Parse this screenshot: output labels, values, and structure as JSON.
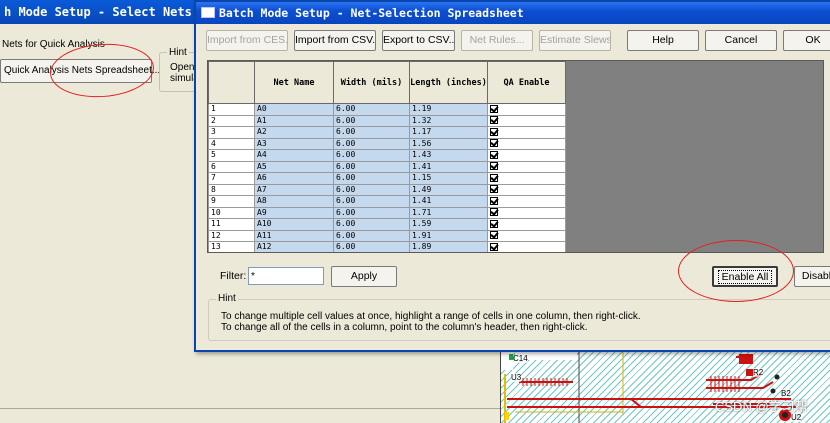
{
  "background_window": {
    "title": "h Mode Setup - Select Nets a",
    "group_label": "Nets for Quick Analysis",
    "qa_button_label": "Quick Analysis Nets Spreadsheet...",
    "hint_label": "Hint",
    "hint_text_line1": "Open",
    "hint_text_line2": "simula"
  },
  "dialog": {
    "title": "Batch Mode Setup - Net-Selection Spreadsheet",
    "toolbar": {
      "import_ces": "Import from CES...",
      "import_csv": "Import from CSV...",
      "export_csv": "Export to CSV...",
      "net_rules": "Net Rules...",
      "estimate_slews": "Estimate Slews",
      "help": "Help",
      "cancel": "Cancel",
      "ok": "OK"
    },
    "columns": [
      "Net Name",
      "Width (mils)",
      "Length (inches)",
      "QA Enable"
    ],
    "rows": [
      {
        "num": "1",
        "name": "A0",
        "width": "6.00",
        "length": "1.19",
        "qa": true
      },
      {
        "num": "2",
        "name": "A1",
        "width": "6.00",
        "length": "1.32",
        "qa": true
      },
      {
        "num": "3",
        "name": "A2",
        "width": "6.00",
        "length": "1.17",
        "qa": true
      },
      {
        "num": "4",
        "name": "A3",
        "width": "6.00",
        "length": "1.56",
        "qa": true
      },
      {
        "num": "5",
        "name": "A4",
        "width": "6.00",
        "length": "1.43",
        "qa": true
      },
      {
        "num": "6",
        "name": "A5",
        "width": "6.00",
        "length": "1.41",
        "qa": true
      },
      {
        "num": "7",
        "name": "A6",
        "width": "6.00",
        "length": "1.15",
        "qa": true
      },
      {
        "num": "8",
        "name": "A7",
        "width": "6.00",
        "length": "1.49",
        "qa": true
      },
      {
        "num": "9",
        "name": "A8",
        "width": "6.00",
        "length": "1.41",
        "qa": true
      },
      {
        "num": "10",
        "name": "A9",
        "width": "6.00",
        "length": "1.71",
        "qa": true
      },
      {
        "num": "11",
        "name": "A10",
        "width": "6.00",
        "length": "1.59",
        "qa": true
      },
      {
        "num": "12",
        "name": "A11",
        "width": "6.00",
        "length": "1.91",
        "qa": true
      },
      {
        "num": "13",
        "name": "A12",
        "width": "6.00",
        "length": "1.89",
        "qa": true
      }
    ],
    "filter": {
      "label": "Filter:",
      "value": "*",
      "apply": "Apply"
    },
    "enable_all": "Enable All",
    "disable_all": "Disabl",
    "hint": {
      "label": "Hint",
      "line1": "To change multiple cell values at once, highlight a range of cells in one column, then right-click.",
      "line2": "To change all of the cells in a column, point to the column's header, then right-click."
    }
  },
  "pcb": {
    "labels": [
      "C14",
      "U3",
      "R2",
      "B2",
      "U2"
    ]
  },
  "watermark": "CSDN @学习帮",
  "colors": {
    "title_bar": "#0b4fd3",
    "selection": "#c4d8ee",
    "annotation": "#e02020",
    "trace": "#cc1111",
    "copper_hatch": "#6fc6c6"
  }
}
